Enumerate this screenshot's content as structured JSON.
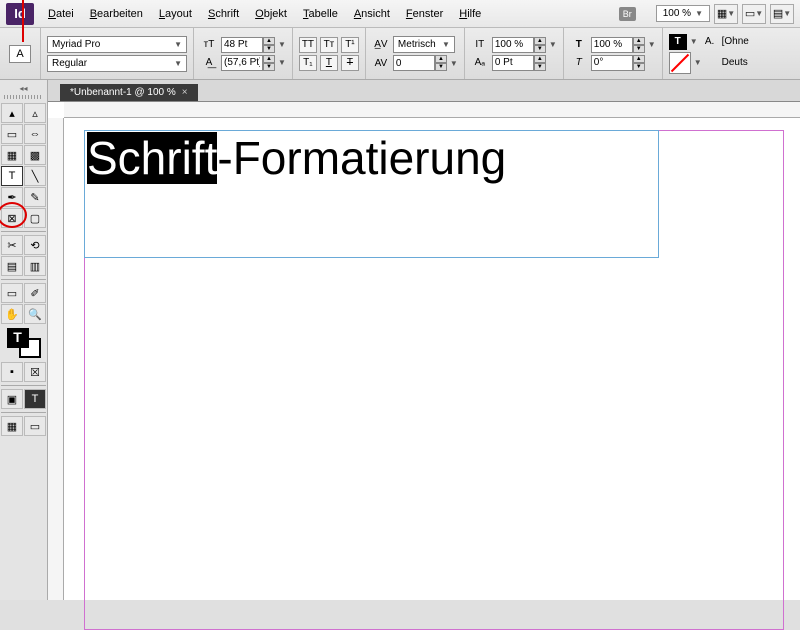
{
  "menubar": {
    "items": [
      "Datei",
      "Bearbeiten",
      "Layout",
      "Schrift",
      "Objekt",
      "Tabelle",
      "Ansicht",
      "Fenster",
      "Hilfe"
    ],
    "zoom": "100 %",
    "br": "Br"
  },
  "controlbar": {
    "mode": "A",
    "font": "Myriad Pro",
    "style": "Regular",
    "size": "48 Pt",
    "leading": "(57,6 Pt)",
    "kerning": "Metrisch",
    "tracking": "0",
    "vscale": "100 %",
    "hscale": "100 %",
    "baseline": "0 Pt",
    "skew": "0°",
    "lang": "Deuts",
    "nostyle": "[Ohne"
  },
  "document": {
    "tab": "*Unbenannt-1 @ 100 %",
    "text_selected": "Schrift",
    "text_rest": "-Formatierung"
  }
}
